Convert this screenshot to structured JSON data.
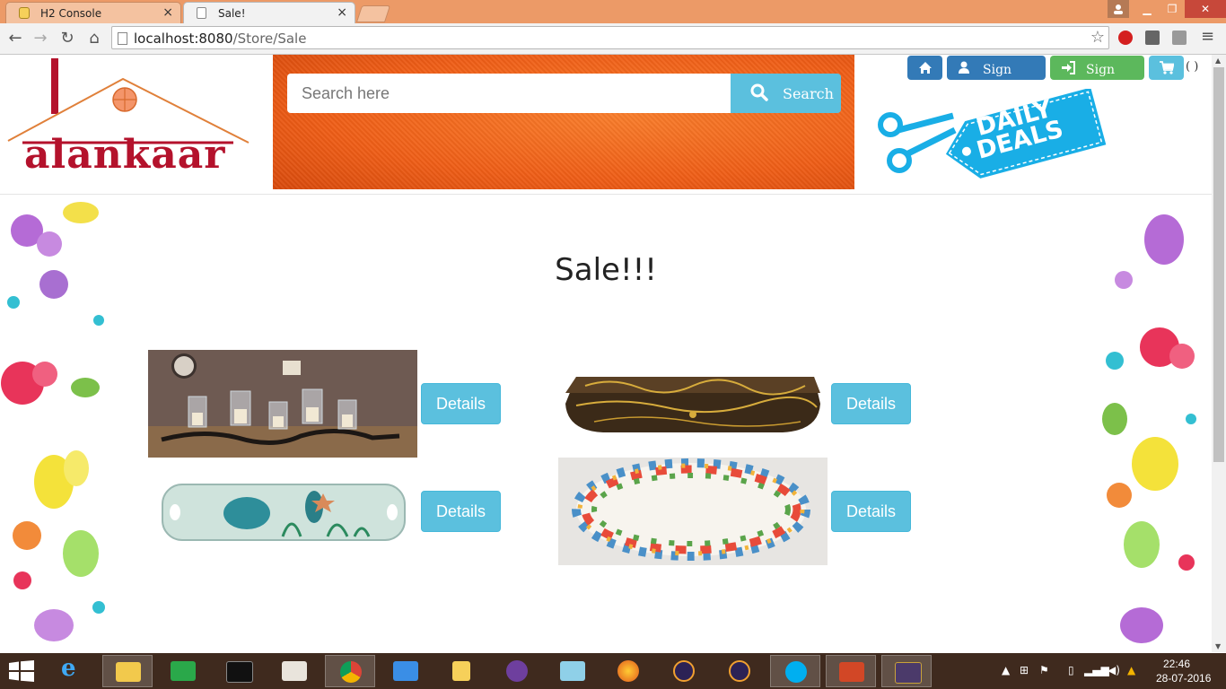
{
  "browser": {
    "tabs": [
      {
        "title": "H2 Console",
        "active": false
      },
      {
        "title": "Sale!",
        "active": true
      }
    ],
    "url_host": "localhost:8080",
    "url_path": "/Store/Sale"
  },
  "site": {
    "logo_text": "alankaar",
    "search": {
      "placeholder": "Search here",
      "button_label": "Search"
    },
    "nav": {
      "signup_label": "Sign Up",
      "signin_label": "Sign In",
      "cart_count": "( )"
    },
    "deals_badge": {
      "line1": "DAILY",
      "line2": "DEALS"
    }
  },
  "main": {
    "title": "Sale!!!",
    "products": [
      {
        "image": "candle-holder",
        "details_label": "Details"
      },
      {
        "image": "wooden-box",
        "details_label": "Details"
      },
      {
        "image": "sea-turtle-tray",
        "details_label": "Details"
      },
      {
        "image": "floral-plate",
        "details_label": "Details"
      }
    ]
  },
  "taskbar": {
    "apps": [
      "internet-explorer",
      "file-explorer",
      "store",
      "command-prompt",
      "reader",
      "chrome",
      "remote-desktop",
      "h2-database",
      "github",
      "notepad",
      "firefox",
      "eclipse",
      "eclipse-2",
      "skype",
      "powerpoint",
      "java-ee-ide"
    ],
    "active_app": "chrome",
    "time": "22:46",
    "date": "28-07-2016"
  },
  "colors": {
    "primary": "#337ab7",
    "success": "#5cb85c",
    "info": "#5bc0de",
    "brand": "#b4122c",
    "banner": "#ef5e17"
  }
}
